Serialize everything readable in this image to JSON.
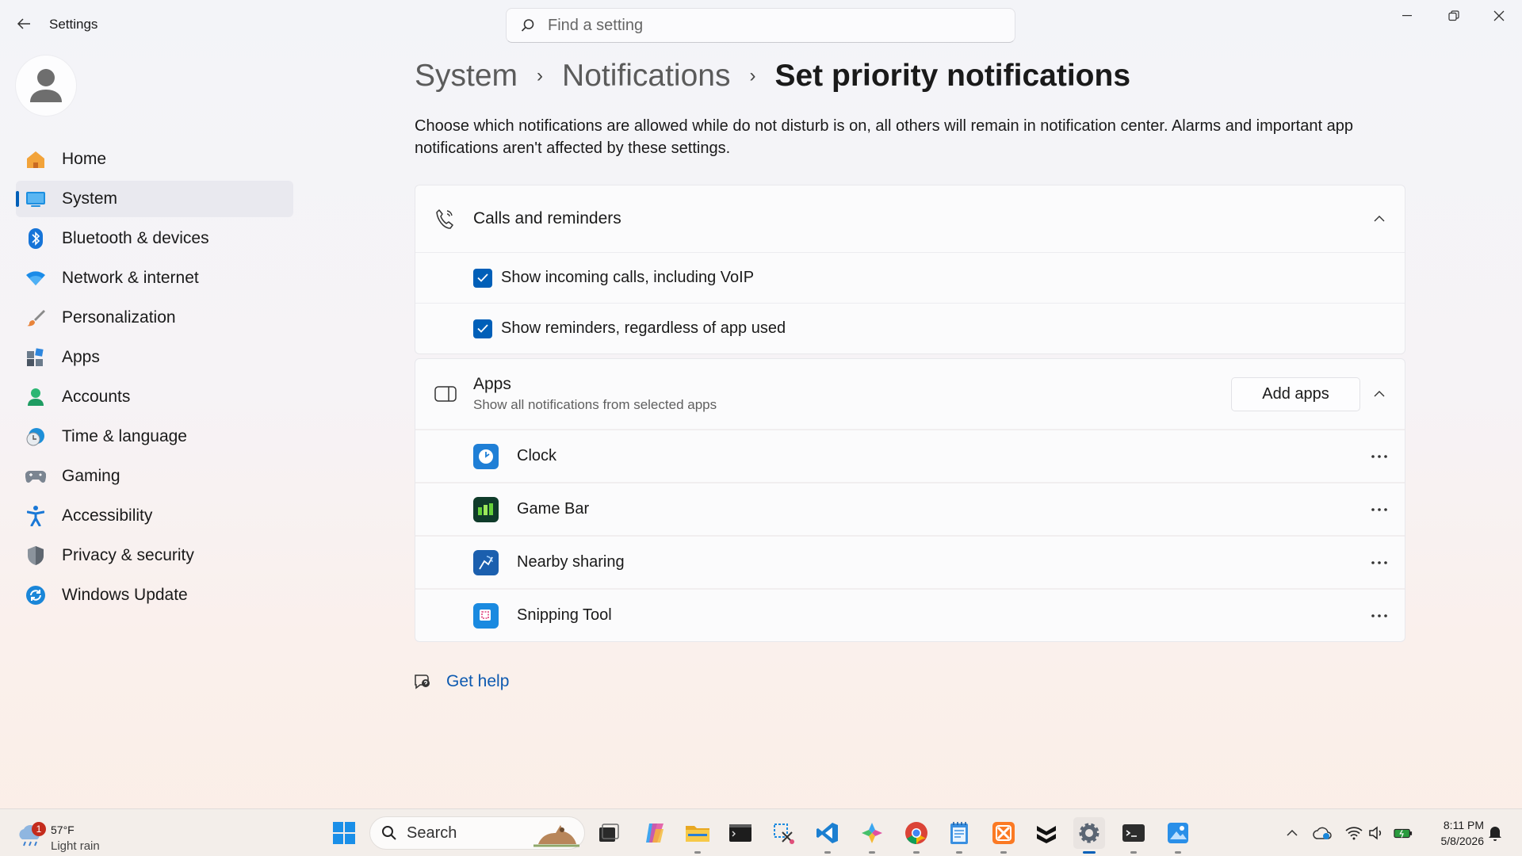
{
  "window": {
    "title": "Settings"
  },
  "search": {
    "placeholder": "Find a setting"
  },
  "sidebar": {
    "items": [
      {
        "label": "Home",
        "icon": "home-icon"
      },
      {
        "label": "System",
        "icon": "system-icon",
        "active": true
      },
      {
        "label": "Bluetooth & devices",
        "icon": "bluetooth-icon"
      },
      {
        "label": "Network & internet",
        "icon": "wifi-icon"
      },
      {
        "label": "Personalization",
        "icon": "brush-icon"
      },
      {
        "label": "Apps",
        "icon": "apps-icon"
      },
      {
        "label": "Accounts",
        "icon": "accounts-icon"
      },
      {
        "label": "Time & language",
        "icon": "time-language-icon"
      },
      {
        "label": "Gaming",
        "icon": "gamepad-icon"
      },
      {
        "label": "Accessibility",
        "icon": "accessibility-icon"
      },
      {
        "label": "Privacy & security",
        "icon": "shield-icon"
      },
      {
        "label": "Windows Update",
        "icon": "update-icon"
      }
    ]
  },
  "breadcrumb": {
    "items": [
      "System",
      "Notifications",
      "Set priority notifications"
    ],
    "separator": "›"
  },
  "description": "Choose which notifications are allowed while do not disturb is on, all others will remain in notification center. Alarms and important app notifications aren't affected by these settings.",
  "calls_card": {
    "title": "Calls and reminders",
    "options": [
      {
        "label": "Show incoming calls, including VoIP",
        "checked": true
      },
      {
        "label": "Show reminders, regardless of app used",
        "checked": true
      }
    ]
  },
  "apps_card": {
    "title": "Apps",
    "subtitle": "Show all notifications from selected apps",
    "add_button": "Add apps",
    "apps": [
      {
        "name": "Clock",
        "icon": "clock-app-icon"
      },
      {
        "name": "Game Bar",
        "icon": "game-bar-icon"
      },
      {
        "name": "Nearby sharing",
        "icon": "nearby-sharing-icon"
      },
      {
        "name": "Snipping Tool",
        "icon": "snipping-tool-icon"
      }
    ]
  },
  "help": {
    "label": "Get help"
  },
  "taskbar": {
    "weather": {
      "temp": "57°F",
      "condition": "Light rain",
      "badge": "1"
    },
    "search_label": "Search",
    "clock": {
      "time": "8:11 PM",
      "date": "5/8/2026"
    }
  },
  "colors": {
    "accent": "#005fb8",
    "link": "#0d5ab0"
  }
}
